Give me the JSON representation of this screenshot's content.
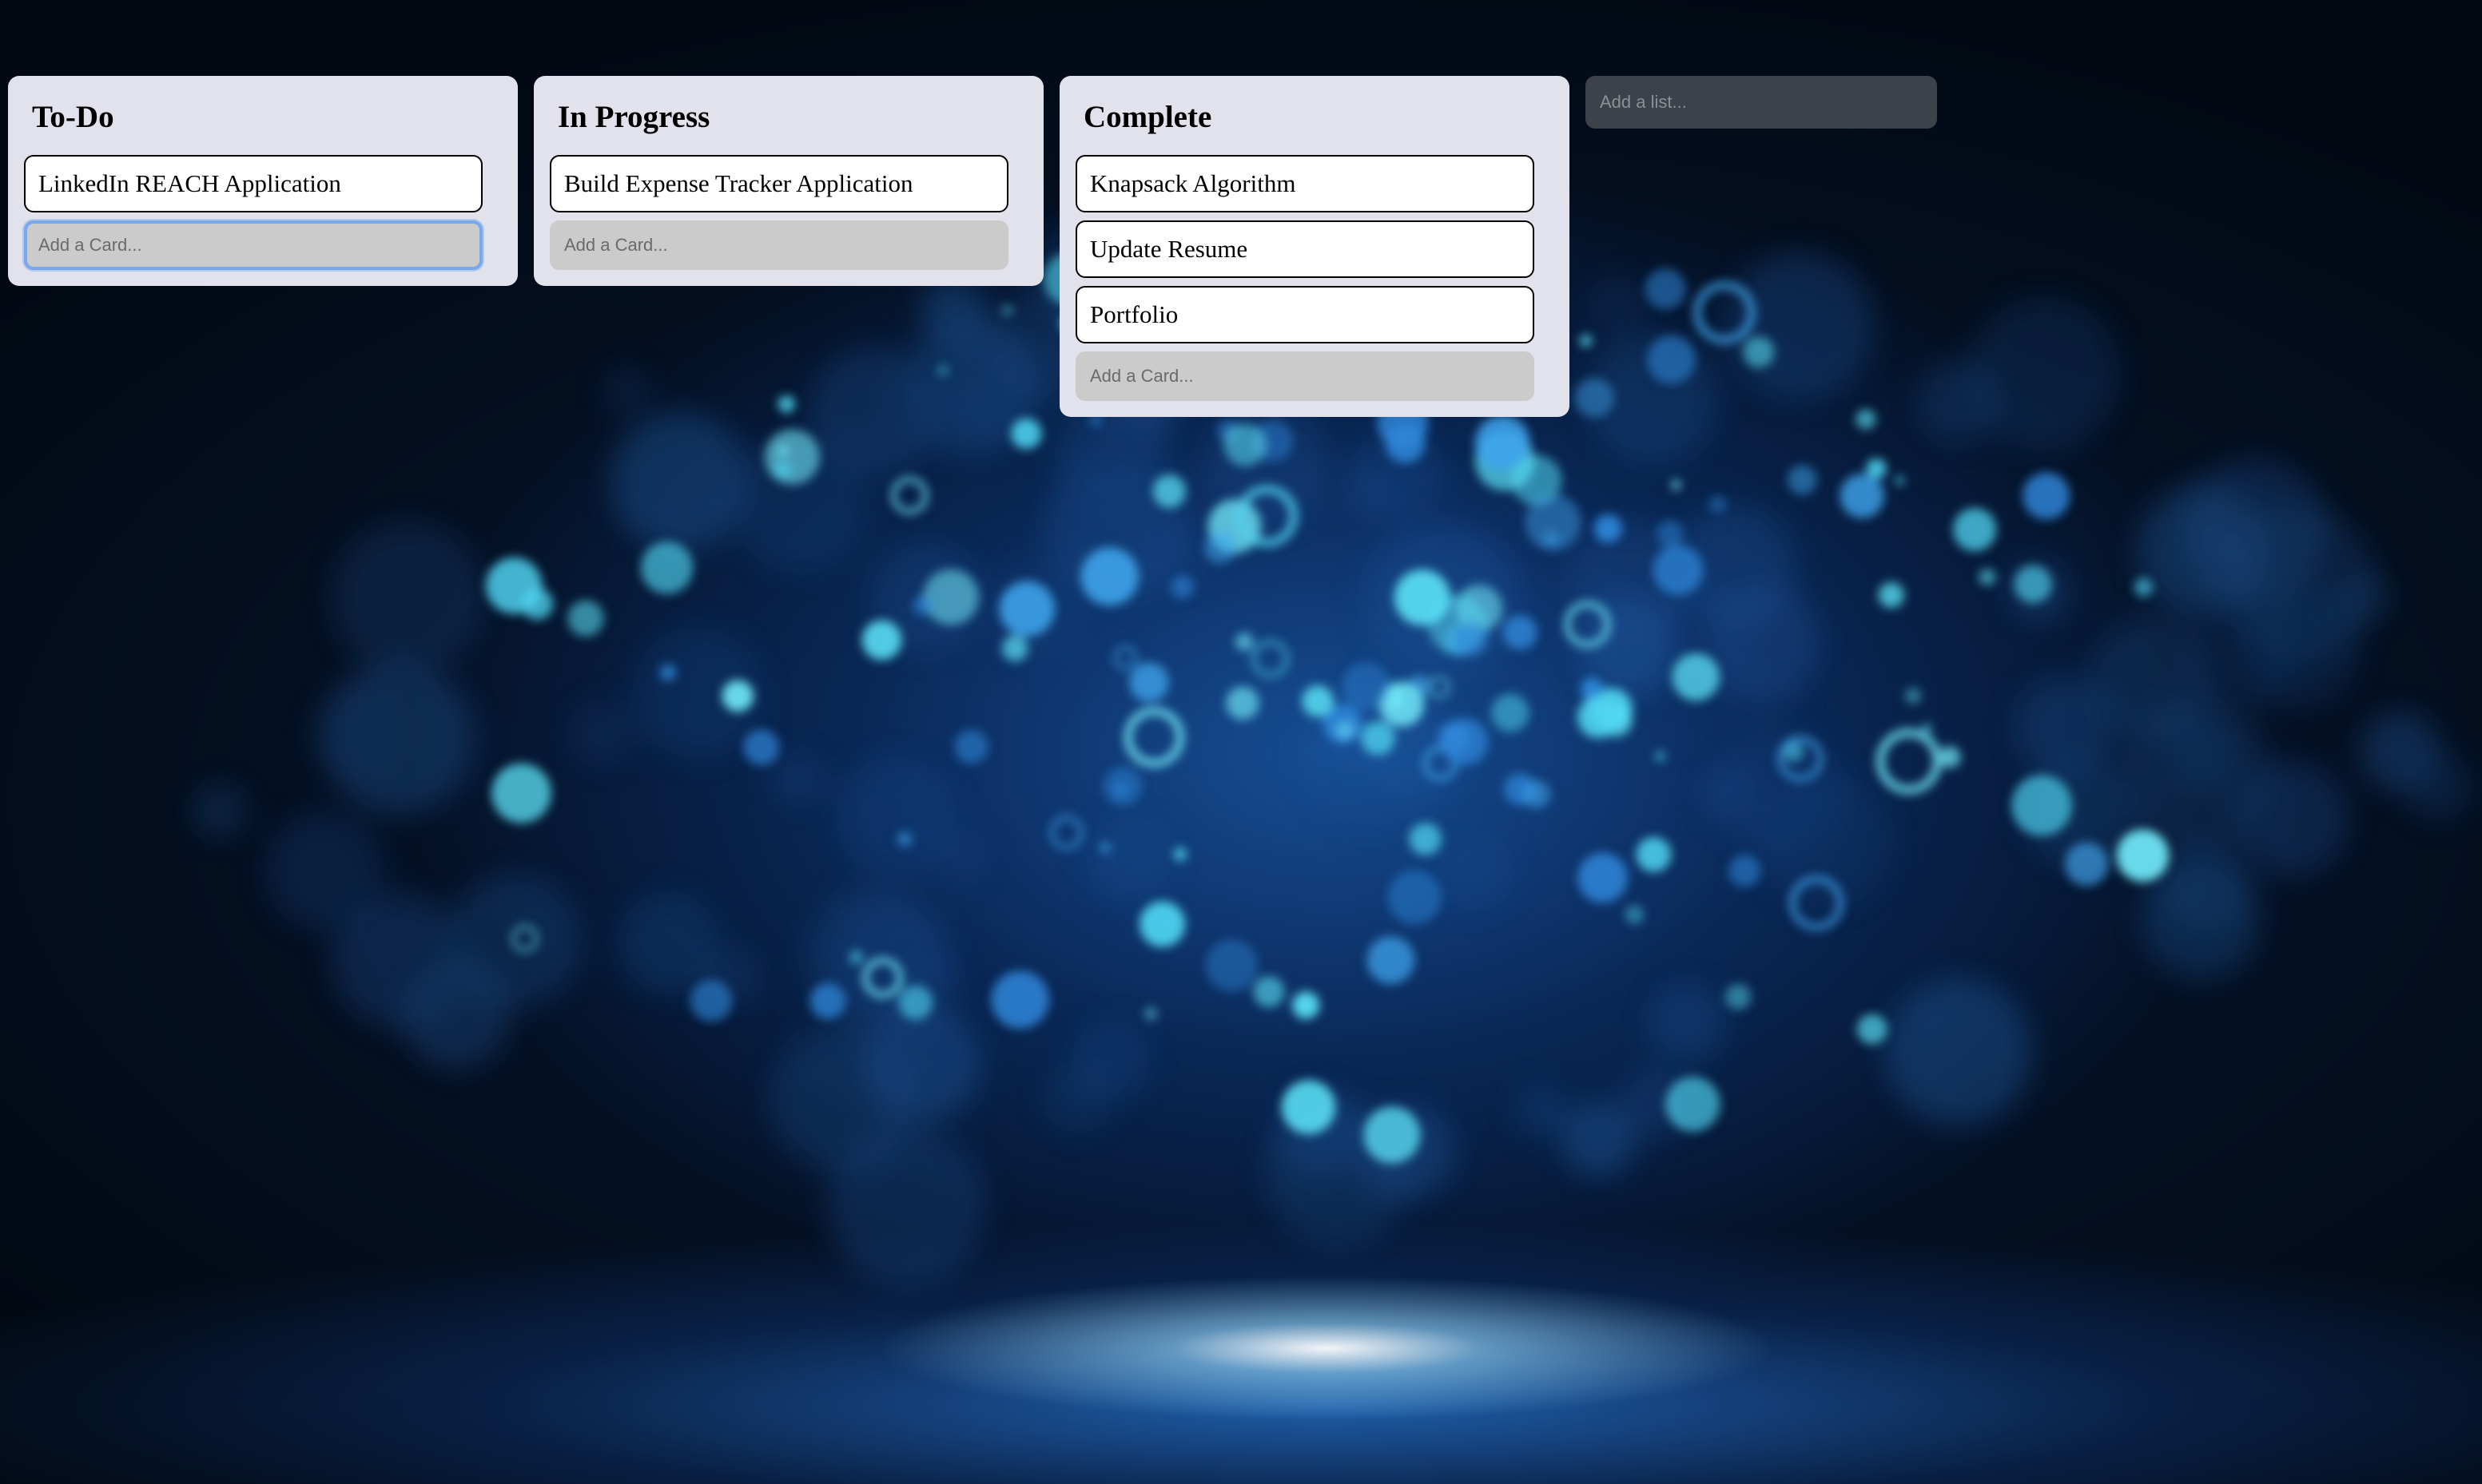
{
  "board": {
    "lists": [
      {
        "title": "To-Do",
        "cards": [
          "LinkedIn REACH Application"
        ],
        "add_card_placeholder": "Add a Card..."
      },
      {
        "title": "In Progress",
        "cards": [
          "Build Expense Tracker Application"
        ],
        "add_card_placeholder": "Add a Card..."
      },
      {
        "title": "Complete",
        "cards": [
          "Knapsack Algorithm",
          "Update Resume",
          "Portfolio"
        ],
        "add_card_placeholder": "Add a Card..."
      }
    ],
    "add_list_placeholder": "Add a list..."
  },
  "colors": {
    "list_bg": "#e2e2ec",
    "card_bg": "#ffffff",
    "add_card_bg": "#cbcbcb",
    "focus_ring": "#7aa8ec",
    "add_list_bg": "#3c4249",
    "page_bg": "#020913",
    "bokeh_accent": "#4fd4f0"
  }
}
